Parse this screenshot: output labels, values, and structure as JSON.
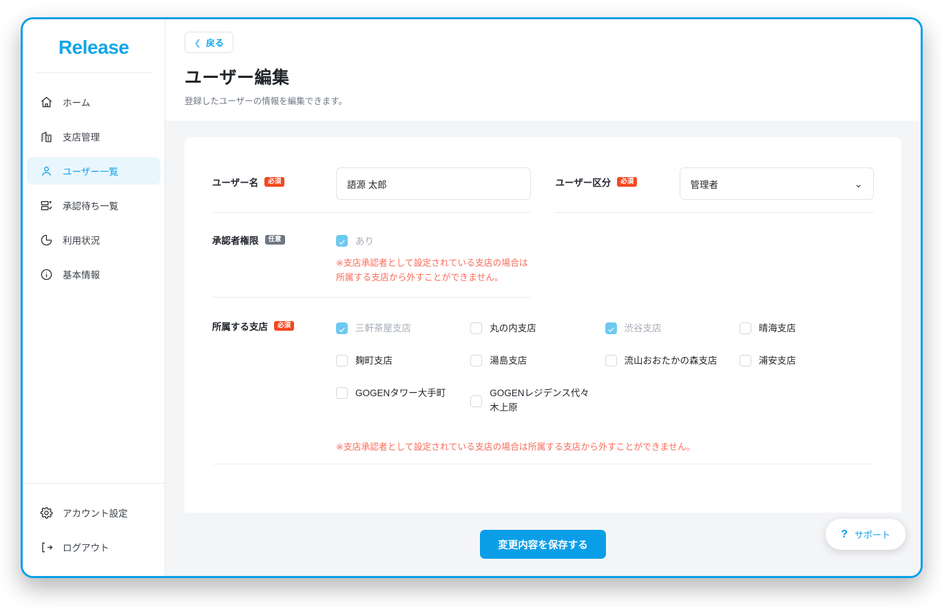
{
  "brand": {
    "logo_text": "Release",
    "accent_color": "#0b9ee8"
  },
  "sidebar": {
    "items": [
      {
        "label": "ホーム",
        "icon": "home-icon",
        "active": false
      },
      {
        "label": "支店管理",
        "icon": "building-icon",
        "active": false
      },
      {
        "label": "ユーザー一覧",
        "icon": "user-icon",
        "active": true
      },
      {
        "label": "承認待ち一覧",
        "icon": "approval-list-icon",
        "active": false
      },
      {
        "label": "利用状況",
        "icon": "pie-chart-icon",
        "active": false
      },
      {
        "label": "基本情報",
        "icon": "info-icon",
        "active": false
      }
    ],
    "bottom_items": [
      {
        "label": "アカウント設定",
        "icon": "gear-icon"
      },
      {
        "label": "ログアウト",
        "icon": "logout-icon"
      }
    ]
  },
  "header": {
    "back_label": "戻る",
    "title": "ユーザー編集",
    "subtitle": "登録したユーザーの情報を編集できます。"
  },
  "form": {
    "badges": {
      "required": "必須",
      "optional": "任意"
    },
    "user_name": {
      "label": "ユーザー名",
      "badge": "必須",
      "value": "語源 太郎"
    },
    "user_type": {
      "label": "ユーザー区分",
      "badge": "必須",
      "value": "管理者",
      "options": [
        "管理者"
      ]
    },
    "approver": {
      "label": "承認者権限",
      "badge": "任意",
      "checkbox_label": "あり",
      "checked": true,
      "disabled": true,
      "note": "※支店承認者として設定されている支店の場合は所属する支店から外すことができません。"
    },
    "branches": {
      "label": "所属する支店",
      "badge": "必須",
      "note": "※支店承認者として設定されている支店の場合は所属する支店から外すことができません。",
      "items": [
        {
          "name": "三軒茶屋支店",
          "checked": true,
          "disabled": true
        },
        {
          "name": "丸の内支店",
          "checked": false,
          "disabled": false
        },
        {
          "name": "渋谷支店",
          "checked": true,
          "disabled": true
        },
        {
          "name": "晴海支店",
          "checked": false,
          "disabled": false
        },
        {
          "name": "麹町支店",
          "checked": false,
          "disabled": false
        },
        {
          "name": "湯島支店",
          "checked": false,
          "disabled": false
        },
        {
          "name": "流山おおたかの森支店",
          "checked": false,
          "disabled": false
        },
        {
          "name": "浦安支店",
          "checked": false,
          "disabled": false
        },
        {
          "name": "GOGENタワー大手町",
          "checked": false,
          "disabled": false
        },
        {
          "name": "GOGENレジデンス代々木上原",
          "checked": false,
          "disabled": false
        }
      ]
    }
  },
  "footer": {
    "save_label": "変更内容を保存する",
    "support_label": "サポート",
    "support_icon": "question-mark-icon"
  }
}
